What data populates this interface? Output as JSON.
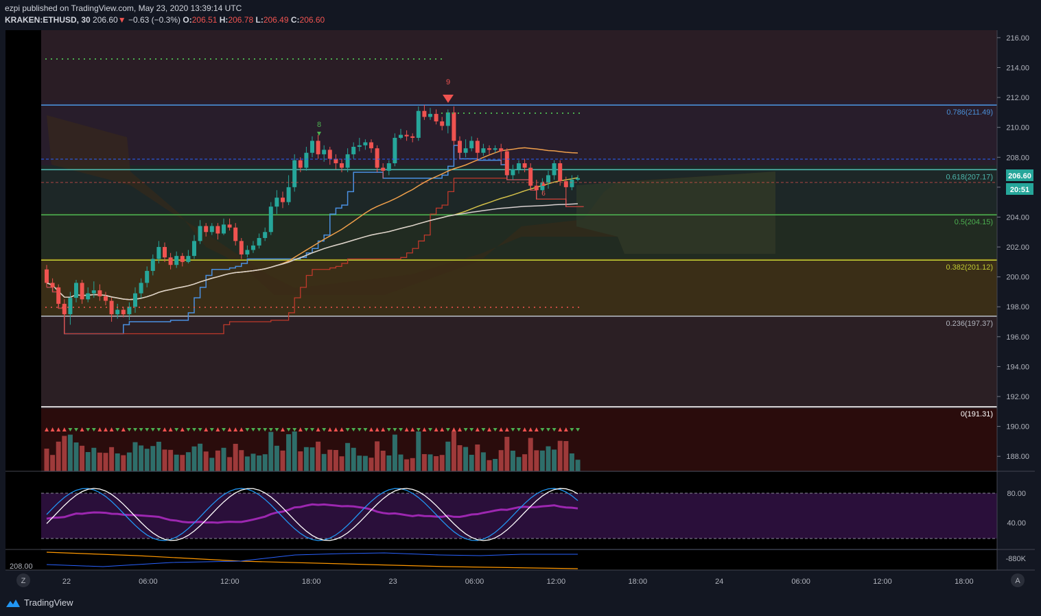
{
  "header": {
    "published": "ezpi published on TradingView.com, May 23, 2020 13:39:14 UTC",
    "symbol": "KRAKEN:ETHUSD, 30",
    "last": "206.60",
    "change": "−0.63 (−0.3%)",
    "o_label": "O:",
    "o": "206.51",
    "h_label": "H:",
    "h": "206.78",
    "l_label": "L:",
    "l": "206.49",
    "c_label": "C:",
    "c": "206.60"
  },
  "price_badge": "206.60",
  "time_badge": "20:51",
  "left_axis_value": "208.00",
  "z_button": "Z",
  "a_button": "A",
  "logo_text": "TradingView",
  "osc_axis": [
    "80.00",
    "40.00"
  ],
  "volume_axis": "-880K",
  "colors": {
    "up": "#26a69a",
    "down": "#ef5350",
    "fib_786": "#2196f3",
    "fib_618": "#26a69a",
    "fib_05": "#4caf50",
    "fib_0382": "#8bc34a",
    "fib_0236": "#b2b5be",
    "fib_0": "#ffffff"
  },
  "chart_data": {
    "type": "candlestick",
    "ylim": [
      187,
      216.5
    ],
    "y_ticks": [
      "216.00",
      "214.00",
      "212.00",
      "210.00",
      "208.00",
      "206.00",
      "204.00",
      "202.00",
      "200.00",
      "198.00",
      "196.00",
      "194.00",
      "192.00",
      "190.00",
      "188.00"
    ],
    "x_ticks": [
      "22",
      "06:00",
      "12:00",
      "18:00",
      "23",
      "06:00",
      "12:00",
      "18:00",
      "24",
      "06:00",
      "12:00",
      "18:00"
    ],
    "fib_levels": [
      {
        "ratio": "0.786",
        "price": 211.49,
        "label": "0.786(211.49)"
      },
      {
        "ratio": "0.618",
        "price": 207.17,
        "label": "0.618(207.17)"
      },
      {
        "ratio": "0.5",
        "price": 204.15,
        "label": "0.5(204.15)"
      },
      {
        "ratio": "0.382",
        "price": 201.12,
        "label": "0.382(201.12)"
      },
      {
        "ratio": "0.236",
        "price": 197.37,
        "label": "0.236(197.37)"
      },
      {
        "ratio": "0",
        "price": 191.31,
        "label": "0(191.31)"
      }
    ],
    "candles": [
      [
        200.5,
        199.6,
        200.8,
        199.3
      ],
      [
        199.6,
        199.3,
        199.9,
        199.0
      ],
      [
        199.3,
        198.2,
        199.5,
        197.9
      ],
      [
        198.2,
        197.5,
        198.5,
        196.2
      ],
      [
        197.5,
        198.6,
        199.0,
        196.8
      ],
      [
        198.6,
        199.6,
        199.8,
        198.3
      ],
      [
        199.6,
        198.5,
        199.8,
        198.2
      ],
      [
        198.5,
        198.9,
        199.3,
        198.3
      ],
      [
        198.9,
        199.1,
        199.7,
        198.6
      ],
      [
        199.1,
        198.7,
        199.5,
        198.4
      ],
      [
        198.7,
        198.4,
        199.0,
        198.1
      ],
      [
        198.4,
        197.5,
        198.6,
        197.0
      ],
      [
        197.5,
        197.8,
        198.2,
        197.2
      ],
      [
        197.8,
        197.5,
        198.0,
        197.3
      ],
      [
        197.5,
        198.0,
        198.3,
        197.1
      ],
      [
        198.0,
        198.9,
        199.3,
        197.6
      ],
      [
        198.9,
        199.6,
        199.9,
        198.6
      ],
      [
        199.6,
        200.4,
        200.7,
        199.3
      ],
      [
        200.4,
        201.2,
        201.5,
        200.1
      ],
      [
        201.2,
        202.0,
        202.4,
        200.9
      ],
      [
        202.0,
        201.3,
        202.3,
        201.0
      ],
      [
        201.3,
        200.8,
        201.6,
        200.5
      ],
      [
        200.8,
        201.4,
        201.7,
        200.6
      ],
      [
        201.4,
        201.0,
        201.6,
        200.7
      ],
      [
        201.0,
        201.4,
        201.8,
        200.9
      ],
      [
        201.4,
        202.4,
        202.8,
        201.2
      ],
      [
        202.4,
        203.4,
        203.8,
        202.2
      ],
      [
        203.4,
        203.0,
        203.6,
        202.7
      ],
      [
        203.0,
        203.4,
        203.6,
        202.8
      ],
      [
        203.4,
        202.9,
        203.6,
        202.5
      ],
      [
        202.9,
        203.5,
        203.9,
        202.8
      ],
      [
        203.5,
        203.3,
        203.9,
        203.1
      ],
      [
        203.3,
        202.4,
        203.6,
        202.1
      ],
      [
        202.4,
        201.5,
        202.6,
        201.2
      ],
      [
        201.5,
        201.8,
        202.1,
        201.3
      ],
      [
        201.8,
        202.1,
        202.4,
        201.6
      ],
      [
        202.1,
        202.6,
        202.9,
        201.9
      ],
      [
        202.6,
        203.0,
        203.3,
        202.4
      ],
      [
        203.0,
        204.7,
        205.0,
        202.8
      ],
      [
        204.7,
        205.3,
        205.8,
        204.2
      ],
      [
        205.3,
        205.0,
        205.7,
        204.6
      ],
      [
        205.0,
        206.0,
        206.8,
        204.8
      ],
      [
        206.0,
        207.8,
        208.2,
        205.7
      ],
      [
        207.8,
        207.3,
        208.0,
        207.0
      ],
      [
        207.3,
        208.3,
        208.7,
        207.1
      ],
      [
        208.3,
        209.1,
        209.4,
        208.0
      ],
      [
        209.1,
        208.2,
        209.5,
        207.9
      ],
      [
        208.2,
        208.5,
        208.8,
        207.7
      ],
      [
        208.5,
        207.9,
        208.7,
        207.5
      ],
      [
        207.9,
        207.6,
        208.2,
        207.2
      ],
      [
        207.6,
        207.3,
        207.9,
        207.0
      ],
      [
        207.3,
        208.2,
        208.6,
        207.0
      ],
      [
        208.2,
        208.7,
        209.0,
        207.9
      ],
      [
        208.7,
        208.8,
        209.3,
        208.4
      ],
      [
        208.8,
        209.0,
        209.2,
        208.5
      ],
      [
        209.0,
        208.6,
        209.2,
        208.3
      ],
      [
        208.6,
        207.3,
        208.8,
        207.0
      ],
      [
        207.3,
        207.1,
        207.6,
        206.6
      ],
      [
        207.1,
        207.6,
        207.8,
        206.8
      ],
      [
        207.6,
        209.3,
        209.6,
        207.4
      ],
      [
        209.3,
        209.5,
        209.9,
        209.2
      ],
      [
        209.5,
        209.4,
        209.8,
        209.1
      ],
      [
        209.4,
        209.3,
        209.6,
        209.0
      ],
      [
        209.3,
        211.1,
        211.4,
        209.1
      ],
      [
        211.1,
        210.7,
        211.5,
        210.5
      ],
      [
        210.7,
        210.9,
        211.3,
        210.5
      ],
      [
        210.9,
        210.4,
        211.2,
        210.2
      ],
      [
        210.4,
        210.1,
        210.7,
        209.8
      ],
      [
        210.1,
        211.0,
        211.2,
        209.6
      ],
      [
        211.0,
        209.1,
        211.4,
        208.8
      ],
      [
        209.1,
        208.3,
        209.4,
        207.9
      ],
      [
        208.3,
        208.6,
        209.2,
        208.0
      ],
      [
        208.6,
        209.1,
        209.4,
        208.4
      ],
      [
        209.1,
        208.3,
        209.3,
        207.8
      ],
      [
        208.3,
        208.6,
        208.9,
        208.1
      ],
      [
        208.6,
        208.5,
        208.8,
        208.2
      ],
      [
        208.5,
        208.6,
        208.8,
        208.3
      ],
      [
        208.6,
        208.4,
        208.9,
        207.5
      ],
      [
        208.4,
        206.8,
        208.6,
        206.5
      ],
      [
        206.8,
        207.2,
        207.5,
        206.5
      ],
      [
        207.2,
        207.6,
        207.8,
        206.9
      ],
      [
        207.6,
        207.3,
        207.9,
        207.0
      ],
      [
        207.3,
        206.1,
        207.6,
        205.8
      ],
      [
        206.1,
        205.8,
        206.5,
        205.2
      ],
      [
        205.8,
        206.3,
        206.6,
        205.5
      ],
      [
        206.3,
        206.8,
        207.1,
        205.9
      ],
      [
        206.8,
        207.6,
        207.8,
        206.5
      ],
      [
        207.6,
        206.4,
        207.8,
        206.1
      ],
      [
        206.4,
        206.0,
        206.7,
        204.7
      ],
      [
        206.0,
        206.5,
        206.8,
        205.8
      ],
      [
        206.5,
        206.6,
        206.8,
        206.4
      ]
    ]
  }
}
